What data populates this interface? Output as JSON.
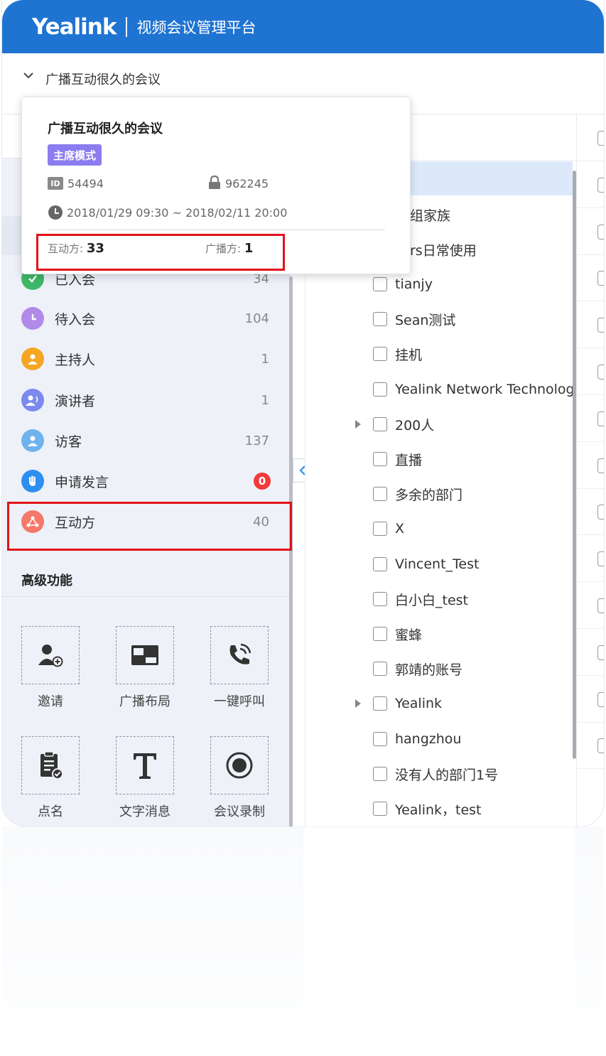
{
  "header": {
    "logo": "Yealink",
    "platform": "视频会议管理平台"
  },
  "conference": {
    "name": "广播互动很久的会议"
  },
  "popup": {
    "title": "广播互动很久的会议",
    "mode_badge": "主席模式",
    "id_icon": "ID",
    "meeting_id": "54494",
    "password": "962245",
    "time_range": "2018/01/29 09:30 ~ 2018/02/11 20:00",
    "interactive_label": "互动方:",
    "interactive_count": "33",
    "broadcast_label": "广播方:",
    "broadcast_count": "1"
  },
  "participant_categories": [
    {
      "label": "已入会",
      "count": "34",
      "icon": "joined-check-icon",
      "color": "#3fb868"
    },
    {
      "label": "待入会",
      "count": "104",
      "icon": "pending-clock-icon",
      "color": "#b18ae8"
    },
    {
      "label": "主持人",
      "count": "1",
      "icon": "host-icon",
      "color": "#f5a623"
    },
    {
      "label": "演讲者",
      "count": "1",
      "icon": "speaker-icon",
      "color": "#7b89f0"
    },
    {
      "label": "访客",
      "count": "137",
      "icon": "guest-icon",
      "color": "#6fb3ee"
    },
    {
      "label": "申请发言",
      "count": "0",
      "icon": "raise-hand-icon",
      "color": "#2e8ff0"
    },
    {
      "label": "互动方",
      "count": "40",
      "icon": "interactive-party-icon",
      "color": "#f5786a"
    }
  ],
  "advanced": {
    "title": "高级功能",
    "features": [
      {
        "label": "邀请",
        "icon": "invite-user-icon"
      },
      {
        "label": "广播布局",
        "icon": "broadcast-layout-icon"
      },
      {
        "label": "一键呼叫",
        "icon": "one-key-call-icon"
      },
      {
        "label": "点名",
        "icon": "roll-call-icon"
      },
      {
        "label": "文字消息",
        "icon": "text-message-icon"
      },
      {
        "label": "会议录制",
        "icon": "record-icon"
      }
    ]
  },
  "tree": {
    "partial_rows": [
      "组家族",
      "rs日常使用"
    ],
    "rows": [
      {
        "label": "tianjy",
        "expandable": false
      },
      {
        "label": "Sean测试",
        "expandable": false
      },
      {
        "label": "挂机",
        "expandable": false
      },
      {
        "label": "Yealink Network Technolog",
        "expandable": false
      },
      {
        "label": "200人",
        "expandable": true
      },
      {
        "label": "直播",
        "expandable": false
      },
      {
        "label": "多余的部门",
        "expandable": false
      },
      {
        "label": "X",
        "expandable": false
      },
      {
        "label": "Vincent_Test",
        "expandable": false
      },
      {
        "label": "白小白_test",
        "expandable": false
      },
      {
        "label": "蜜蜂",
        "expandable": false
      },
      {
        "label": "郭靖的账号",
        "expandable": false
      },
      {
        "label": "Yealink",
        "expandable": true
      },
      {
        "label": "hangzhou",
        "expandable": false
      },
      {
        "label": "没有人的部门1号",
        "expandable": false
      },
      {
        "label": "Yealink，test",
        "expandable": false
      }
    ]
  },
  "colors": {
    "header": "#1f74d2",
    "highlight": "#e3121a",
    "badge": "#8c7cf0",
    "alert": "#f23a3a"
  }
}
